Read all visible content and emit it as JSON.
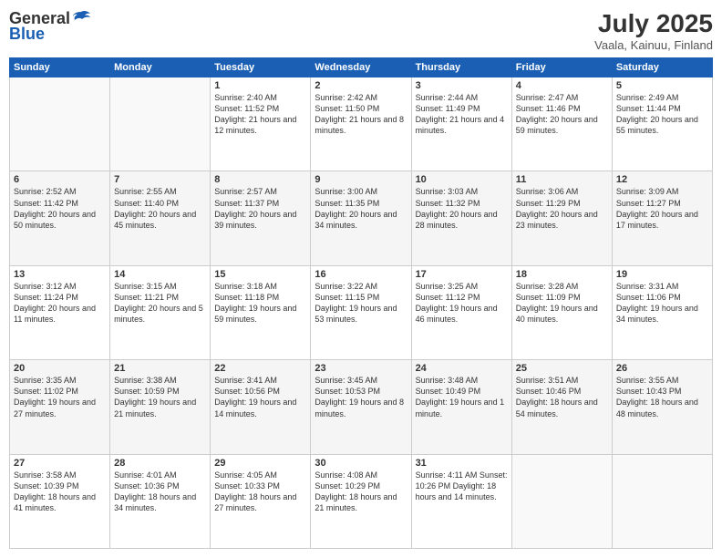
{
  "header": {
    "logo_general": "General",
    "logo_blue": "Blue",
    "title": "July 2025",
    "location": "Vaala, Kainuu, Finland"
  },
  "weekdays": [
    "Sunday",
    "Monday",
    "Tuesday",
    "Wednesday",
    "Thursday",
    "Friday",
    "Saturday"
  ],
  "weeks": [
    [
      {
        "day": "",
        "info": ""
      },
      {
        "day": "",
        "info": ""
      },
      {
        "day": "1",
        "info": "Sunrise: 2:40 AM\nSunset: 11:52 PM\nDaylight: 21 hours\nand 12 minutes."
      },
      {
        "day": "2",
        "info": "Sunrise: 2:42 AM\nSunset: 11:50 PM\nDaylight: 21 hours\nand 8 minutes."
      },
      {
        "day": "3",
        "info": "Sunrise: 2:44 AM\nSunset: 11:49 PM\nDaylight: 21 hours\nand 4 minutes."
      },
      {
        "day": "4",
        "info": "Sunrise: 2:47 AM\nSunset: 11:46 PM\nDaylight: 20 hours\nand 59 minutes."
      },
      {
        "day": "5",
        "info": "Sunrise: 2:49 AM\nSunset: 11:44 PM\nDaylight: 20 hours\nand 55 minutes."
      }
    ],
    [
      {
        "day": "6",
        "info": "Sunrise: 2:52 AM\nSunset: 11:42 PM\nDaylight: 20 hours\nand 50 minutes."
      },
      {
        "day": "7",
        "info": "Sunrise: 2:55 AM\nSunset: 11:40 PM\nDaylight: 20 hours\nand 45 minutes."
      },
      {
        "day": "8",
        "info": "Sunrise: 2:57 AM\nSunset: 11:37 PM\nDaylight: 20 hours\nand 39 minutes."
      },
      {
        "day": "9",
        "info": "Sunrise: 3:00 AM\nSunset: 11:35 PM\nDaylight: 20 hours\nand 34 minutes."
      },
      {
        "day": "10",
        "info": "Sunrise: 3:03 AM\nSunset: 11:32 PM\nDaylight: 20 hours\nand 28 minutes."
      },
      {
        "day": "11",
        "info": "Sunrise: 3:06 AM\nSunset: 11:29 PM\nDaylight: 20 hours\nand 23 minutes."
      },
      {
        "day": "12",
        "info": "Sunrise: 3:09 AM\nSunset: 11:27 PM\nDaylight: 20 hours\nand 17 minutes."
      }
    ],
    [
      {
        "day": "13",
        "info": "Sunrise: 3:12 AM\nSunset: 11:24 PM\nDaylight: 20 hours\nand 11 minutes."
      },
      {
        "day": "14",
        "info": "Sunrise: 3:15 AM\nSunset: 11:21 PM\nDaylight: 20 hours\nand 5 minutes."
      },
      {
        "day": "15",
        "info": "Sunrise: 3:18 AM\nSunset: 11:18 PM\nDaylight: 19 hours\nand 59 minutes."
      },
      {
        "day": "16",
        "info": "Sunrise: 3:22 AM\nSunset: 11:15 PM\nDaylight: 19 hours\nand 53 minutes."
      },
      {
        "day": "17",
        "info": "Sunrise: 3:25 AM\nSunset: 11:12 PM\nDaylight: 19 hours\nand 46 minutes."
      },
      {
        "day": "18",
        "info": "Sunrise: 3:28 AM\nSunset: 11:09 PM\nDaylight: 19 hours\nand 40 minutes."
      },
      {
        "day": "19",
        "info": "Sunrise: 3:31 AM\nSunset: 11:06 PM\nDaylight: 19 hours\nand 34 minutes."
      }
    ],
    [
      {
        "day": "20",
        "info": "Sunrise: 3:35 AM\nSunset: 11:02 PM\nDaylight: 19 hours\nand 27 minutes."
      },
      {
        "day": "21",
        "info": "Sunrise: 3:38 AM\nSunset: 10:59 PM\nDaylight: 19 hours\nand 21 minutes."
      },
      {
        "day": "22",
        "info": "Sunrise: 3:41 AM\nSunset: 10:56 PM\nDaylight: 19 hours\nand 14 minutes."
      },
      {
        "day": "23",
        "info": "Sunrise: 3:45 AM\nSunset: 10:53 PM\nDaylight: 19 hours\nand 8 minutes."
      },
      {
        "day": "24",
        "info": "Sunrise: 3:48 AM\nSunset: 10:49 PM\nDaylight: 19 hours\nand 1 minute."
      },
      {
        "day": "25",
        "info": "Sunrise: 3:51 AM\nSunset: 10:46 PM\nDaylight: 18 hours\nand 54 minutes."
      },
      {
        "day": "26",
        "info": "Sunrise: 3:55 AM\nSunset: 10:43 PM\nDaylight: 18 hours\nand 48 minutes."
      }
    ],
    [
      {
        "day": "27",
        "info": "Sunrise: 3:58 AM\nSunset: 10:39 PM\nDaylight: 18 hours\nand 41 minutes."
      },
      {
        "day": "28",
        "info": "Sunrise: 4:01 AM\nSunset: 10:36 PM\nDaylight: 18 hours\nand 34 minutes."
      },
      {
        "day": "29",
        "info": "Sunrise: 4:05 AM\nSunset: 10:33 PM\nDaylight: 18 hours\nand 27 minutes."
      },
      {
        "day": "30",
        "info": "Sunrise: 4:08 AM\nSunset: 10:29 PM\nDaylight: 18 hours\nand 21 minutes."
      },
      {
        "day": "31",
        "info": "Sunrise: 4:11 AM\nSunset: 10:26 PM\nDaylight: 18 hours\nand 14 minutes."
      },
      {
        "day": "",
        "info": ""
      },
      {
        "day": "",
        "info": ""
      }
    ]
  ]
}
